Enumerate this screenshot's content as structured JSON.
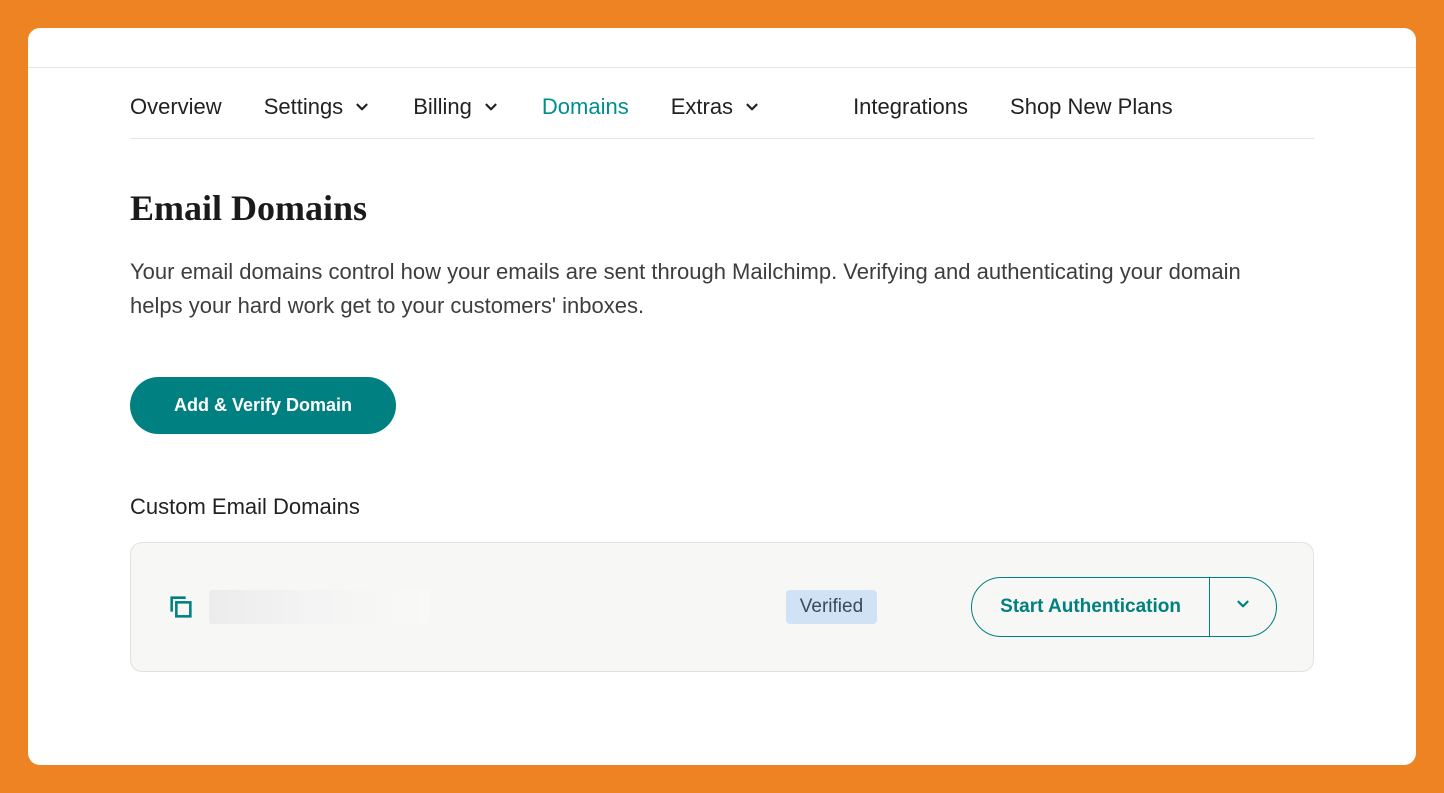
{
  "tabs": {
    "overview": "Overview",
    "settings": "Settings",
    "billing": "Billing",
    "domains": "Domains",
    "extras": "Extras",
    "integrations": "Integrations",
    "shop": "Shop New Plans"
  },
  "page": {
    "title": "Email Domains",
    "description": "Your email domains control how your emails are sent through Mailchimp. Verifying and authenticating your domain helps your hard work get to your customers' inboxes.",
    "add_button": "Add & Verify Domain",
    "custom_section": "Custom Email Domains"
  },
  "domain_row": {
    "status_badge": "Verified",
    "auth_button": "Start Authentication"
  }
}
